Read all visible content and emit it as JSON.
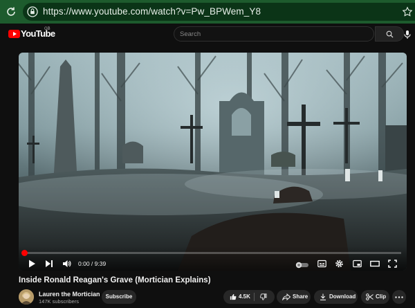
{
  "browser": {
    "url": "https://www.youtube.com/watch?v=Pw_BPWem_Y8"
  },
  "masthead": {
    "logo_text": "YouTube",
    "country_code": "GB",
    "search_placeholder": "Search"
  },
  "player": {
    "time_display": "0:00 / 9:39",
    "progress_fraction": 0.0,
    "accent": "#ff0000"
  },
  "video": {
    "title": "Inside Ronald Reagan's Grave (Mortician Explains)",
    "channel_name": "Lauren the Mortician",
    "subscribers": "147K subscribers",
    "subscribe_label": "Subscribe",
    "like_count": "4.5K",
    "share_label": "Share",
    "download_label": "Download",
    "clip_label": "Clip"
  },
  "icons": {
    "browser": [
      "reload-icon",
      "site-info-icon",
      "bookmark-star-icon"
    ],
    "masthead": [
      "youtube-logo-icon",
      "search-icon",
      "microphone-icon"
    ],
    "player": [
      "play-icon",
      "next-icon",
      "volume-icon",
      "autoplay-toggle-icon",
      "subtitles-icon",
      "settings-gear-icon",
      "miniplayer-icon",
      "theater-mode-icon",
      "fullscreen-icon"
    ],
    "actions": [
      "thumbs-up-icon",
      "thumbs-down-icon",
      "share-arrow-icon",
      "download-icon",
      "scissors-icon",
      "more-dots-icon"
    ]
  }
}
